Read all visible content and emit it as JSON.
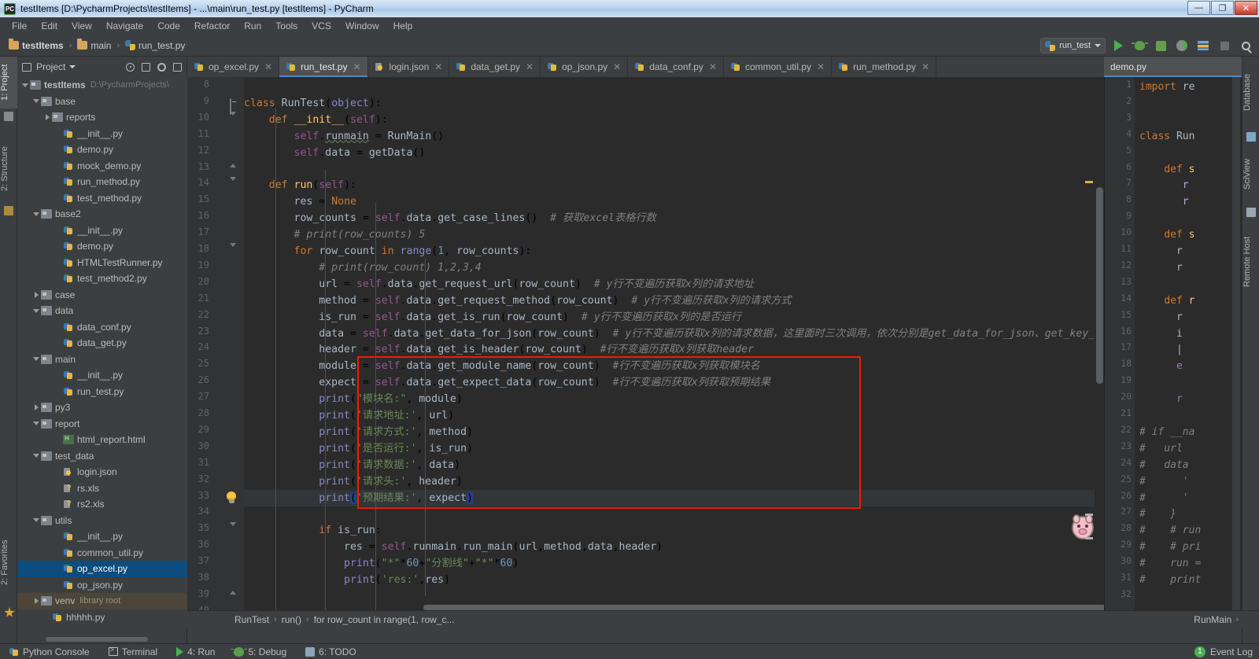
{
  "window": {
    "title": "testItems [D:\\PycharmProjects\\testItems] - ...\\main\\run_test.py [testItems] - PyCharm",
    "app_icon": "pycharm-icon",
    "minimize": "—",
    "maximize": "❐",
    "close": "✕"
  },
  "menu": [
    "File",
    "Edit",
    "View",
    "Navigate",
    "Code",
    "Refactor",
    "Run",
    "Tools",
    "VCS",
    "Window",
    "Help"
  ],
  "breadcrumb": {
    "project": "testItems",
    "folder": "main",
    "file": "run_test.py",
    "separator": "›"
  },
  "toolbar": {
    "run_config": "run_test",
    "buttons": [
      "run-button",
      "debug-button",
      "coverage-button",
      "profile-button",
      "rerun-button",
      "stop-button",
      "search-button"
    ]
  },
  "left_tool_tabs": [
    {
      "label": "1: Project",
      "selected": true
    },
    {
      "label": "2: Structure",
      "selected": false
    },
    {
      "label": "2: Favorites",
      "selected": false
    }
  ],
  "right_tool_tabs": [
    "Database",
    "SciView",
    "Remote Host"
  ],
  "project_panel": {
    "title": "Project",
    "tree": [
      {
        "indent": 0,
        "arrow": "down",
        "icon": "folder-root",
        "label": "testItems",
        "sub": "D:\\PycharmProjects\\",
        "bold": true
      },
      {
        "indent": 1,
        "arrow": "down",
        "icon": "folder",
        "label": "base"
      },
      {
        "indent": 2,
        "arrow": "right",
        "icon": "folder",
        "label": "reports"
      },
      {
        "indent": 3,
        "arrow": "none",
        "icon": "py",
        "label": "__init__.py"
      },
      {
        "indent": 3,
        "arrow": "none",
        "icon": "py",
        "label": "demo.py"
      },
      {
        "indent": 3,
        "arrow": "none",
        "icon": "py",
        "label": "mock_demo.py"
      },
      {
        "indent": 3,
        "arrow": "none",
        "icon": "py",
        "label": "run_method.py"
      },
      {
        "indent": 3,
        "arrow": "none",
        "icon": "py",
        "label": "test_method.py"
      },
      {
        "indent": 1,
        "arrow": "down",
        "icon": "folder",
        "label": "base2"
      },
      {
        "indent": 3,
        "arrow": "none",
        "icon": "py",
        "label": "__init__.py"
      },
      {
        "indent": 3,
        "arrow": "none",
        "icon": "py",
        "label": "demo.py"
      },
      {
        "indent": 3,
        "arrow": "none",
        "icon": "py",
        "label": "HTMLTestRunner.py"
      },
      {
        "indent": 3,
        "arrow": "none",
        "icon": "py",
        "label": "test_method2.py"
      },
      {
        "indent": 1,
        "arrow": "right",
        "icon": "folder",
        "label": "case"
      },
      {
        "indent": 1,
        "arrow": "down",
        "icon": "folder",
        "label": "data"
      },
      {
        "indent": 3,
        "arrow": "none",
        "icon": "py",
        "label": "data_conf.py"
      },
      {
        "indent": 3,
        "arrow": "none",
        "icon": "py",
        "label": "data_get.py"
      },
      {
        "indent": 1,
        "arrow": "down",
        "icon": "folder",
        "label": "main"
      },
      {
        "indent": 3,
        "arrow": "none",
        "icon": "py",
        "label": "__init__.py"
      },
      {
        "indent": 3,
        "arrow": "none",
        "icon": "py",
        "label": "run_test.py"
      },
      {
        "indent": 1,
        "arrow": "right",
        "icon": "folder",
        "label": "py3"
      },
      {
        "indent": 1,
        "arrow": "down",
        "icon": "folder",
        "label": "report"
      },
      {
        "indent": 3,
        "arrow": "none",
        "icon": "html",
        "label": "html_report.html"
      },
      {
        "indent": 1,
        "arrow": "down",
        "icon": "folder",
        "label": "test_data"
      },
      {
        "indent": 3,
        "arrow": "none",
        "icon": "json",
        "label": "login.json"
      },
      {
        "indent": 3,
        "arrow": "none",
        "icon": "xls",
        "label": "rs.xls"
      },
      {
        "indent": 3,
        "arrow": "none",
        "icon": "xls",
        "label": "rs2.xls"
      },
      {
        "indent": 1,
        "arrow": "down",
        "icon": "folder",
        "label": "utils"
      },
      {
        "indent": 3,
        "arrow": "none",
        "icon": "py",
        "label": "__init__.py"
      },
      {
        "indent": 3,
        "arrow": "none",
        "icon": "py",
        "label": "common_util.py"
      },
      {
        "indent": 3,
        "arrow": "none",
        "icon": "py",
        "label": "op_excel.py",
        "selected": true
      },
      {
        "indent": 3,
        "arrow": "none",
        "icon": "py",
        "label": "op_json.py"
      },
      {
        "indent": 1,
        "arrow": "right",
        "icon": "folder",
        "label": "venv",
        "sub2": "library root",
        "venv": true
      },
      {
        "indent": 2,
        "arrow": "none",
        "icon": "py",
        "label": "hhhhh.py"
      }
    ]
  },
  "editor_tabs": [
    {
      "label": "op_excel.py",
      "icon": "py",
      "active": false
    },
    {
      "label": "run_test.py",
      "icon": "py",
      "active": true
    },
    {
      "label": "login.json",
      "icon": "json",
      "active": false
    },
    {
      "label": "data_get.py",
      "icon": "py",
      "active": false
    },
    {
      "label": "op_json.py",
      "icon": "py",
      "active": false
    },
    {
      "label": "data_conf.py",
      "icon": "py",
      "active": false
    },
    {
      "label": "common_util.py",
      "icon": "py",
      "active": false
    },
    {
      "label": "run_method.py",
      "icon": "py",
      "active": false
    }
  ],
  "right_editor_tab": "demo.py",
  "code": {
    "first_line": 8,
    "lines": [
      {
        "n": 8,
        "html": ""
      },
      {
        "n": 9,
        "html": "<span class=\"kw\">class</span> <span class=\"cls\">RunTest</span>(<span class=\"bif\">object</span>):"
      },
      {
        "n": 10,
        "html": "    <span class=\"kw\">def</span> <span class=\"fn\">__init__</span>(<span class=\"self\">self</span>):"
      },
      {
        "n": 11,
        "html": "        <span class=\"self\">self</span>.<span class=\"id err\">runmain</span> = <span class=\"cls\">RunMain</span>()"
      },
      {
        "n": 12,
        "html": "        <span class=\"self\">self</span>.<span class=\"id\">data</span> = <span class=\"cls\">getData</span>()"
      },
      {
        "n": 13,
        "html": ""
      },
      {
        "n": 14,
        "html": "    <span class=\"kw\">def</span> <span class=\"fn\">run</span>(<span class=\"self\">self</span>):"
      },
      {
        "n": 15,
        "html": "        <span class=\"id\">res</span> = <span class=\"kw\">None</span>"
      },
      {
        "n": 16,
        "html": "        <span class=\"id\">row_counts</span> = <span class=\"self\">self</span>.<span class=\"id\">data</span>.<span class=\"id\">get_case_lines</span>()  <span class=\"cmt\"># 获取excel表格行数</span>"
      },
      {
        "n": 17,
        "html": "        <span class=\"cmt\"># print(row_counts) 5</span>"
      },
      {
        "n": 18,
        "html": "        <span class=\"kw\">for</span> <span class=\"id\">row_count</span> <span class=\"kw\">in</span> <span class=\"bif\">range</span>(<span class=\"num\">1</span>, <span class=\"id\">row_counts</span>):"
      },
      {
        "n": 19,
        "html": "            <span class=\"cmt\"># print(row_count) 1,2,3,4</span>"
      },
      {
        "n": 20,
        "html": "            <span class=\"id\">url</span> = <span class=\"self\">self</span>.<span class=\"id\">data</span>.<span class=\"id\">get_request_url</span>(<span class=\"id\">row_count</span>)  <span class=\"cmt\"># y行不变遍历获取x列的请求地址</span>"
      },
      {
        "n": 21,
        "html": "            <span class=\"id\">method</span> = <span class=\"self\">self</span>.<span class=\"id\">data</span>.<span class=\"id\">get_request_method</span>(<span class=\"id\">row_count</span>)  <span class=\"cmt\"># y行不变遍历获取x列的请求方式</span>"
      },
      {
        "n": 22,
        "html": "            <span class=\"id\">is_run</span> = <span class=\"self\">self</span>.<span class=\"id\">data</span>.<span class=\"id\">get_is_run</span>(<span class=\"id\">row_count</span>)  <span class=\"cmt\"># y行不变遍历获取x列的是否运行</span>"
      },
      {
        "n": 23,
        "html": "            <span class=\"id\">data</span> = <span class=\"self\">self</span>.<span class=\"id\">data</span>.<span class=\"id\">get_data_for_json</span>(<span class=\"id\">row_count</span>)  <span class=\"cmt\"># y行不变遍历获取x列的请求数据，这里面时三次调用，依次分别是get_data_for_json、get_key_wo</span>"
      },
      {
        "n": 24,
        "html": "            <span class=\"id\">header</span> = <span class=\"self\">self</span>.<span class=\"id\">data</span>.<span class=\"id\">get_is_header</span>(<span class=\"id\">row_count</span>)  <span class=\"cmt\">#行不变遍历获取x列获取header</span>"
      },
      {
        "n": 25,
        "html": "            <span class=\"id\">module</span> = <span class=\"self\">self</span>.<span class=\"id\">data</span>.<span class=\"id\">get_module_name</span>(<span class=\"id\">row_count</span>)  <span class=\"cmt\">#行不变遍历获取x列获取模块名</span>"
      },
      {
        "n": 26,
        "html": "            <span class=\"id\">expect</span> = <span class=\"self\">self</span>.<span class=\"id\">data</span>.<span class=\"id\">get_expect_data</span>(<span class=\"id\">row_count</span>)  <span class=\"cmt\">#行不变遍历获取x列获取预期结果</span>"
      },
      {
        "n": 27,
        "html": "            <span class=\"bif\">print</span>(<span class=\"str\">\"模块名:\"</span>, <span class=\"id\">module</span>)"
      },
      {
        "n": 28,
        "html": "            <span class=\"bif\">print</span>(<span class=\"str\">'请求地址:'</span>, <span class=\"id\">url</span>)"
      },
      {
        "n": 29,
        "html": "            <span class=\"bif\">print</span>(<span class=\"str\">'请求方式:'</span>, <span class=\"id\">method</span>)"
      },
      {
        "n": 30,
        "html": "            <span class=\"bif\">print</span>(<span class=\"str\">'是否运行:'</span>, <span class=\"id\">is_run</span>)"
      },
      {
        "n": 31,
        "html": "            <span class=\"bif\">print</span>(<span class=\"str\">'请求数据:'</span>, <span class=\"id\">data</span>)"
      },
      {
        "n": 32,
        "html": "            <span class=\"bif\">print</span>(<span class=\"str\">'请求头:'</span>, <span class=\"id\">header</span>)"
      },
      {
        "n": 33,
        "html": "            <span class=\"bif\">print</span><span class=\"sel-par\">(</span><span class=\"str\">'预期结果:'</span>, <span class=\"id\">expect</span><span class=\"sel-par\">)</span>"
      },
      {
        "n": 34,
        "html": ""
      },
      {
        "n": 35,
        "html": "            <span class=\"kw\">if</span> <span class=\"id\">is_run</span>:"
      },
      {
        "n": 36,
        "html": "                <span class=\"id\">res</span> = <span class=\"self\">self</span>.<span class=\"id\">runmain</span>.<span class=\"id\">run_main</span>(<span class=\"id\">url</span>,<span class=\"id\">method</span>,<span class=\"id\">data</span>,<span class=\"id\">header</span>)"
      },
      {
        "n": 37,
        "html": "                <span class=\"bif\">print</span>(<span class=\"str\">\"*\"</span>*<span class=\"num\">60</span>+<span class=\"str\">\"分割线\"</span>+<span class=\"str\">\"*\"</span>*<span class=\"num\">60</span>)"
      },
      {
        "n": 38,
        "html": "                <span class=\"bif\">print</span>(<span class=\"str\">'res:'</span>,<span class=\"id\">res</span>)"
      },
      {
        "n": 39,
        "html": ""
      },
      {
        "n": 40,
        "html": ""
      }
    ],
    "highlighted_line": 33,
    "red_box_lines": [
      25,
      33
    ],
    "intention_bulb_line": 33
  },
  "right_editor": {
    "first_line": 1,
    "lines": [
      {
        "n": 1,
        "html": "<span class=\"kw\">import</span> <span class=\"id\">re</span>"
      },
      {
        "n": 2,
        "html": ""
      },
      {
        "n": 3,
        "html": ""
      },
      {
        "n": 4,
        "html": "<span class=\"kw\">class</span> <span class=\"cls\">Run</span>"
      },
      {
        "n": 5,
        "html": ""
      },
      {
        "n": 6,
        "html": "    <span class=\"kw\">def</span> <span class=\"fn\">s</span>"
      },
      {
        "n": 7,
        "html": "       <span class=\"id\">r</span>"
      },
      {
        "n": 8,
        "html": "       <span class=\"id\">r</span>"
      },
      {
        "n": 9,
        "html": ""
      },
      {
        "n": 10,
        "html": "    <span class=\"kw\">def</span> <span class=\"fn\">s</span>"
      },
      {
        "n": 11,
        "html": "      <span class=\"id\">r</span>"
      },
      {
        "n": 12,
        "html": "      <span class=\"id\">r</span>"
      },
      {
        "n": 13,
        "html": ""
      },
      {
        "n": 14,
        "html": "    <span class=\"kw\">def</span> <span class=\"fn\">r</span>"
      },
      {
        "n": 15,
        "html": "      <span class=\"id\">r</span>"
      },
      {
        "n": 16,
        "html": "      <span class=\"id\">i</span>"
      },
      {
        "n": 17,
        "html": "      <span class=\"id\">|</span>"
      },
      {
        "n": 18,
        "html": "      <span class=\"fld\">e</span>"
      },
      {
        "n": 19,
        "html": ""
      },
      {
        "n": 20,
        "html": "      <span class=\"fld\">r</span>"
      },
      {
        "n": 21,
        "html": ""
      },
      {
        "n": 22,
        "html": "<span class=\"cmt\"># if __na</span>"
      },
      {
        "n": 23,
        "html": "<span class=\"cmt\">#   url</span>"
      },
      {
        "n": 24,
        "html": "<span class=\"cmt\">#   data</span>"
      },
      {
        "n": 25,
        "html": "<span class=\"cmt\">#      '</span>"
      },
      {
        "n": 26,
        "html": "<span class=\"cmt\">#      '</span>"
      },
      {
        "n": 27,
        "html": "<span class=\"cmt\">#    }</span>"
      },
      {
        "n": 28,
        "html": "<span class=\"cmt\">#    # run</span>"
      },
      {
        "n": 29,
        "html": "<span class=\"cmt\">#    # pri</span>"
      },
      {
        "n": 30,
        "html": "<span class=\"cmt\">#    run =</span>"
      },
      {
        "n": 31,
        "html": "<span class=\"cmt\">#    print</span>"
      },
      {
        "n": 32,
        "html": ""
      }
    ]
  },
  "nav_breadcrumb": {
    "items": [
      "RunTest",
      "run()",
      "for row_count in range(1, row_c..."
    ],
    "separator": "›",
    "right_item": "RunMain"
  },
  "status_bar": {
    "items": [
      {
        "label": "Python Console",
        "icon": "python-console-icon"
      },
      {
        "label": "Terminal",
        "icon": "terminal-icon"
      },
      {
        "label": "4: Run",
        "icon": "run-icon"
      },
      {
        "label": "5: Debug",
        "icon": "debug-icon"
      },
      {
        "label": "6: TODO",
        "icon": "todo-icon"
      }
    ],
    "event_log": "Event Log",
    "event_count": "1"
  },
  "colors": {
    "accent": "#4a88c7",
    "selection": "#0d4c7c",
    "red_box": "#ff1500",
    "editor_bg": "#2b2b2b",
    "panel_bg": "#3c3f41",
    "keyword": "#cc7832",
    "string": "#6a8759",
    "comment": "#808080",
    "number": "#6897bb",
    "function": "#ffc66d",
    "self": "#94558d",
    "builtin": "#8888c6"
  }
}
